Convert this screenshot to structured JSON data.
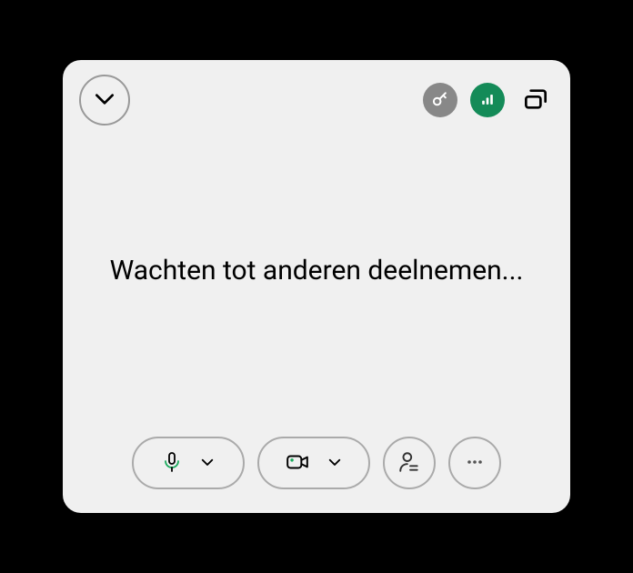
{
  "main": {
    "status_text": "Wachten tot anderen deelnemen..."
  },
  "colors": {
    "accent_green": "#148b58",
    "indicator_green": "#1aaa5d",
    "icon_grey": "#666"
  }
}
